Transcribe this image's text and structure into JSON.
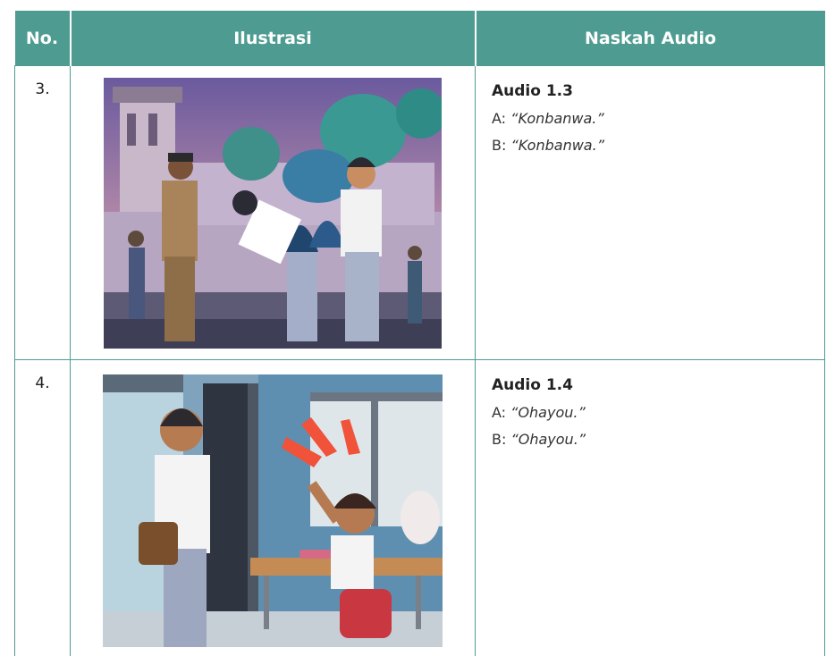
{
  "table": {
    "headers": {
      "no": "No.",
      "illustration": "Ilustrasi",
      "script": "Naskah Audio"
    },
    "rows": [
      {
        "no": "3.",
        "illustration_icon": "mosque-greeting-illustration",
        "audio_title": "Audio 1.3",
        "lines": [
          {
            "speaker": "A:",
            "text": "“Konbanwa.”"
          },
          {
            "speaker": "B:",
            "text": "“Konbanwa.”"
          }
        ]
      },
      {
        "no": "4.",
        "illustration_icon": "classroom-greeting-illustration",
        "audio_title": "Audio 1.4",
        "lines": [
          {
            "speaker": "A:",
            "text": "“Ohayou.”"
          },
          {
            "speaker": "B:",
            "text": "“Ohayou.”"
          }
        ]
      }
    ]
  },
  "colors": {
    "header_bg": "#4e9c91",
    "border": "#4e9c91"
  }
}
